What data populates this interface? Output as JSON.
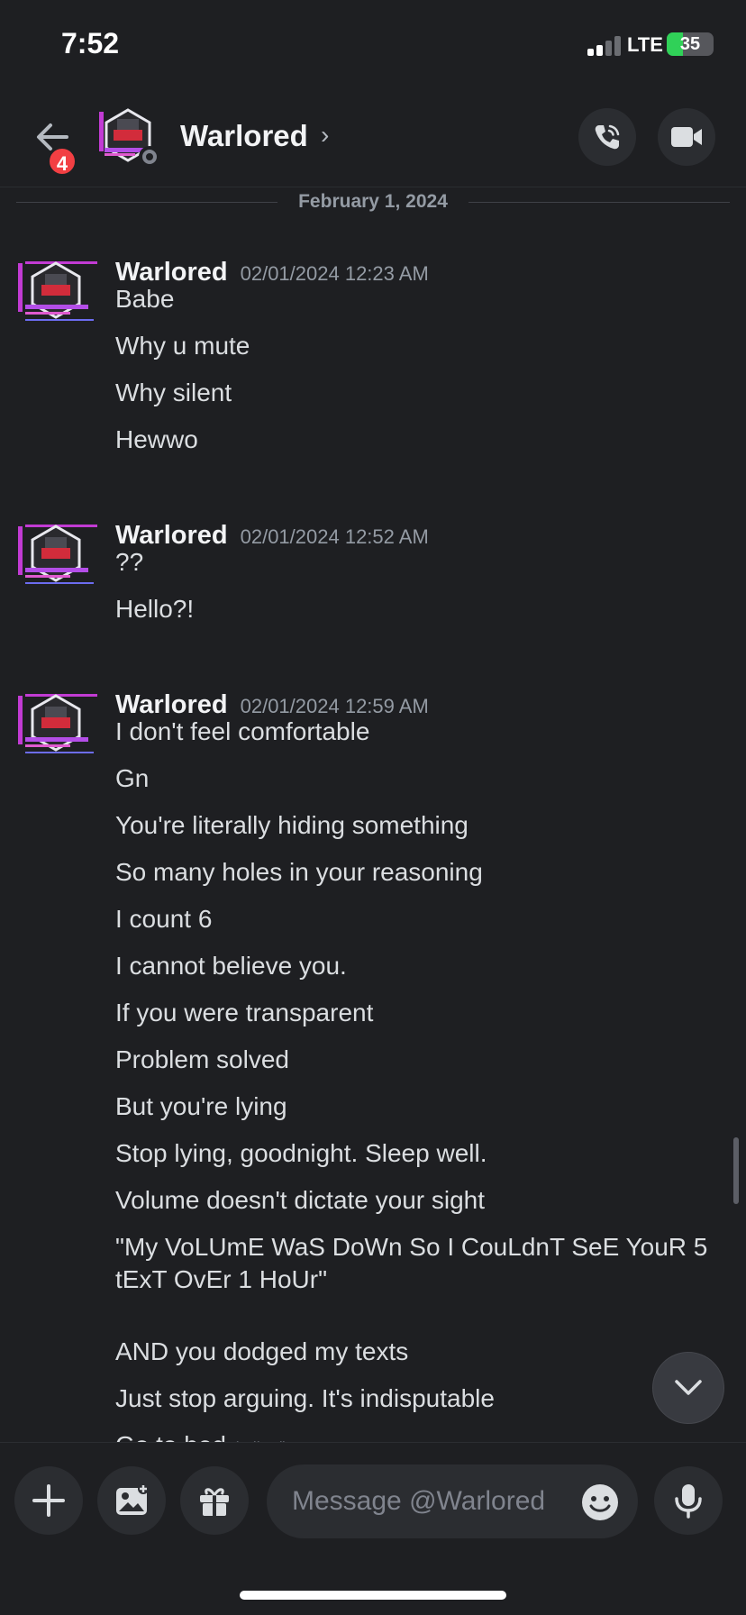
{
  "status_bar": {
    "time": "7:52",
    "network": "LTE",
    "battery": "35",
    "battery_level": 0.35
  },
  "header": {
    "back_badge": "4",
    "username": "Warlored",
    "chevron": "›"
  },
  "date_divider": "February 1, 2024",
  "messages": [
    {
      "author": "Warlored",
      "timestamp": "02/01/2024 12:23 AM",
      "lines": [
        "Babe",
        "Why u mute",
        "Why silent",
        "Hewwo"
      ]
    },
    {
      "author": "Warlored",
      "timestamp": "02/01/2024 12:52 AM",
      "lines": [
        "??",
        "Hello?!"
      ]
    },
    {
      "author": "Warlored",
      "timestamp": "02/01/2024 12:59 AM",
      "lines": [
        "I don't feel comfortable",
        "Gn",
        "You're literally hiding something",
        "So many holes in your reasoning",
        "I count 6",
        "I cannot believe you.",
        "If you were transparent",
        "Problem solved",
        "But you're lying",
        "Stop lying, goodnight. Sleep well.",
        "Volume doesn't dictate your sight",
        "\"My VoLUmE WaS DoWn So I CouLdnT SeE YouR 5 tExT OvEr 1 HoUr\"",
        "AND you dodged my texts",
        "Just stop arguing. It's indisputable",
        "Go to bed"
      ],
      "edited_label": "(edited)"
    }
  ],
  "composer": {
    "placeholder": "Message @Warlored"
  },
  "colors": {
    "background": "#1e1f22",
    "surface": "#2b2d31",
    "badge": "#f23f43",
    "battery": "#30d158"
  },
  "icons": [
    "back-arrow-icon",
    "phone-call-icon",
    "video-camera-icon",
    "plus-icon",
    "image-icon",
    "gift-icon",
    "emoji-icon",
    "microphone-icon",
    "chevron-down-icon"
  ]
}
